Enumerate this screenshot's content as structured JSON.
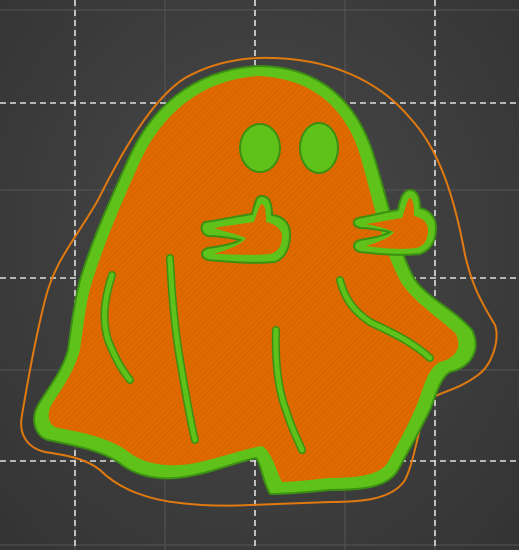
{
  "scene": {
    "type": "3d-slicer-preview",
    "colors": {
      "bed_background": "#3c3c3c",
      "grid_line": "#f2f2f2",
      "major_grid_line": "#6a6a6a",
      "infill": "#e06a00",
      "perimeter": "#5ec21a",
      "perimeter_dark": "#3c8f12",
      "skirt": "#e07a10"
    },
    "model": {
      "name": "ghost",
      "features": [
        "left-eye",
        "right-eye",
        "left-hand",
        "right-hand",
        "body",
        "legs"
      ]
    }
  }
}
